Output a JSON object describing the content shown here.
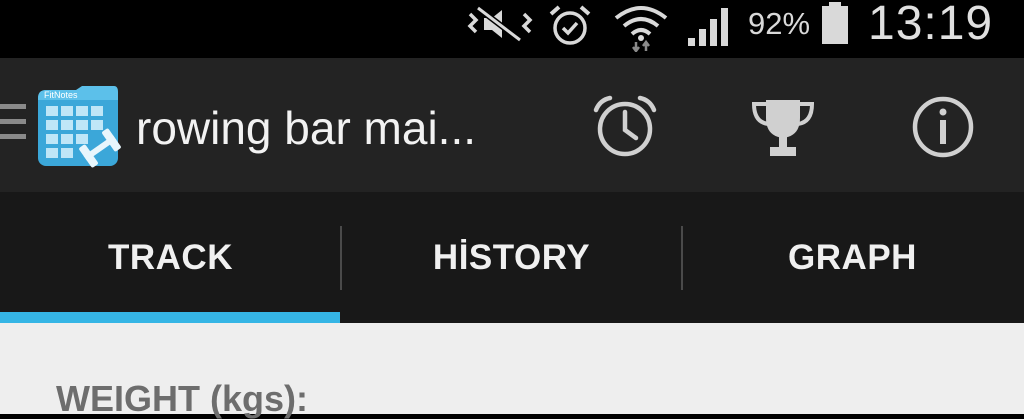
{
  "status_bar": {
    "icons": [
      "mute-vibrate-icon",
      "alarm-clock-icon",
      "wifi-icon",
      "signal-icon",
      "battery-icon"
    ],
    "battery_percent": "92%",
    "time": "13:19"
  },
  "action_bar": {
    "app_logo": "fitnotes-logo",
    "title": "rowing bar mai...",
    "actions": [
      "alarm-clock-icon",
      "trophy-icon",
      "info-icon"
    ]
  },
  "tabs": [
    {
      "label": "TRACK",
      "active": true
    },
    {
      "label": "HİSTORY",
      "active": false
    },
    {
      "label": "GRAPH",
      "active": false
    }
  ],
  "content": {
    "weight_label": "WEIGHT (kgs):"
  },
  "colors": {
    "accent": "#35b5e5",
    "action_bar": "#232323",
    "tab_bar": "#181818",
    "content_bg": "#eeeeee"
  }
}
